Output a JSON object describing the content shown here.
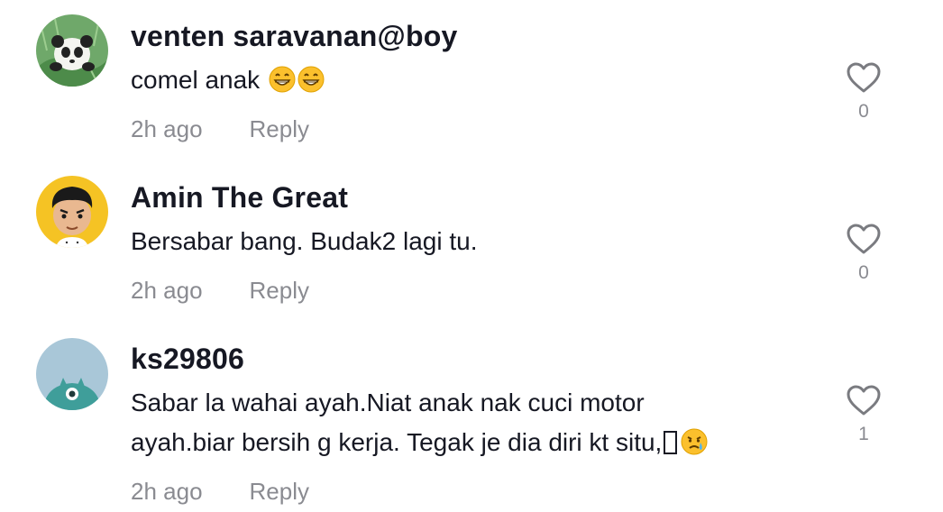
{
  "comments": [
    {
      "username": "venten saravanan@boy",
      "text_lines": [
        "comel anak "
      ],
      "emojis": [
        "grinning-face-emoji",
        "grinning-face-emoji"
      ],
      "time": "2h ago",
      "reply_label": "Reply",
      "like_count": "0",
      "avatar": "panda-avatar"
    },
    {
      "username": "Amin The Great",
      "text_lines": [
        "Bersabar bang. Budak2 lagi tu."
      ],
      "time": "2h ago",
      "reply_label": "Reply",
      "like_count": "0",
      "avatar": "cartoon-boy-avatar"
    },
    {
      "username": "ks29806",
      "text_lines": [
        "Sabar la wahai ayah.Niat anak nak cuci motor",
        "ayah.biar bersih g kerja. Tegak je dia diri kt situ,"
      ],
      "emojis": [
        "unknown-glyph",
        "crying-face-emoji"
      ],
      "time": "2h ago",
      "reply_label": "Reply",
      "like_count": "1",
      "avatar": "blue-creature-avatar"
    }
  ],
  "colors": {
    "text": "#161823",
    "secondary": "#8a8b91",
    "icon": "#7a7b80"
  }
}
